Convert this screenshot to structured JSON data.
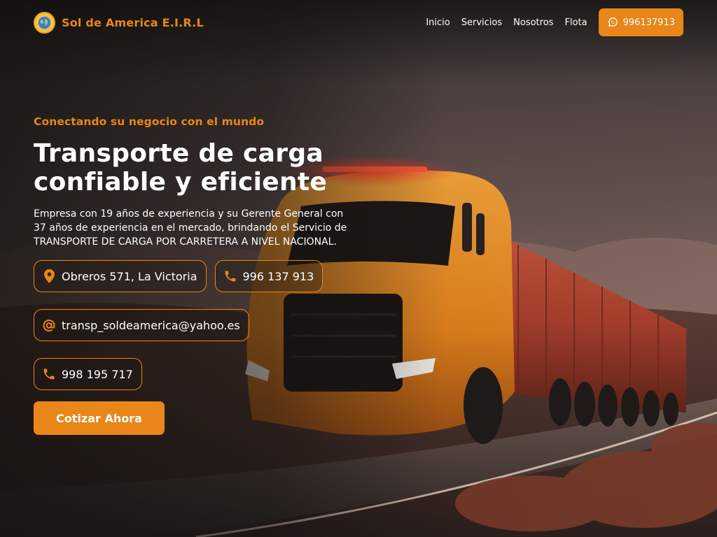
{
  "header": {
    "brand_name": "Sol de America E.I.R.L",
    "nav": [
      "Inicio",
      "Servicios",
      "Nosotros",
      "Flota"
    ],
    "whatsapp_label": "996137913"
  },
  "hero": {
    "tagline": "Conectando su negocio con el mundo",
    "title_line1": "Transporte de carga",
    "title_line2": "confiable y eficiente",
    "description": "Empresa con 19 años de experiencia y su Gerente General con 37 años de experiencia en el mercado, brindando el Servicio de TRANSPORTE DE CARGA POR CARRETERA A NIVEL NACIONAL.",
    "contacts": {
      "address": "Obreros 571, La Victoria",
      "phone1": "996 137 913",
      "email": "transp_soldeamerica@yahoo.es",
      "phone2": "998 195 717"
    },
    "cta_label": "Cotizar Ahora"
  },
  "colors": {
    "accent": "#e8861a",
    "text": "#ffffff"
  },
  "icons": [
    "globe-logo-icon",
    "whatsapp-icon",
    "map-pin-icon",
    "phone-icon",
    "at-sign-icon"
  ]
}
